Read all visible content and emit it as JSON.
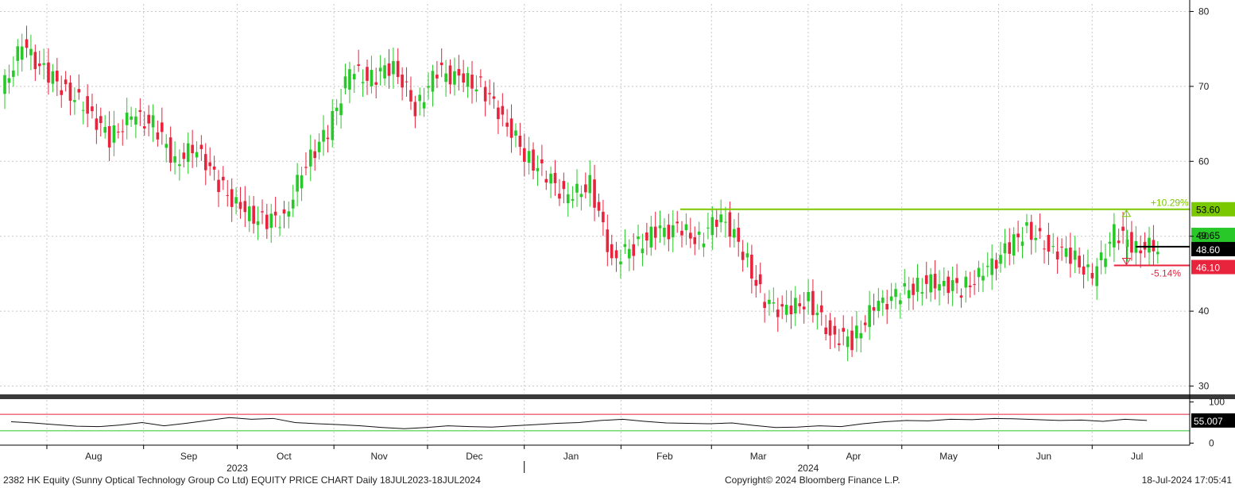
{
  "chart_data": {
    "type": "candlestick",
    "instrument": "2382 HK Equity",
    "price_axis": {
      "ticks": [
        30,
        40,
        50,
        60,
        70,
        80
      ],
      "tick_labels": [
        "30",
        "40",
        "50",
        "60",
        "70",
        "80"
      ],
      "ylim": [
        29,
        81
      ]
    },
    "osc_axis": {
      "ticks": [
        0,
        100
      ],
      "tick_labels": [
        "0",
        "100"
      ],
      "ylim": [
        -5,
        105
      ],
      "upper_band": 70,
      "lower_band": 30
    },
    "x_axis": {
      "months": [
        "Aug",
        "Sep",
        "Oct",
        "Nov",
        "Dec",
        "Jan",
        "Feb",
        "Mar",
        "Apr",
        "May",
        "Jun",
        "Jul"
      ],
      "years": [
        "2023",
        "2024"
      ],
      "start": "2023-07-18",
      "end": "2024-07-18"
    },
    "price_series": [
      {
        "date": "2023-07-18",
        "close": 69.0
      },
      {
        "date": "2023-07-25",
        "close": 75.5
      },
      {
        "date": "2023-08-01",
        "close": 72.0
      },
      {
        "date": "2023-08-08",
        "close": 69.5
      },
      {
        "date": "2023-08-15",
        "close": 67.0
      },
      {
        "date": "2023-08-22",
        "close": 63.0
      },
      {
        "date": "2023-08-29",
        "close": 66.0
      },
      {
        "date": "2023-09-05",
        "close": 65.0
      },
      {
        "date": "2023-09-12",
        "close": 60.0
      },
      {
        "date": "2023-09-19",
        "close": 62.0
      },
      {
        "date": "2023-09-26",
        "close": 57.0
      },
      {
        "date": "2023-10-03",
        "close": 53.5
      },
      {
        "date": "2023-10-10",
        "close": 52.0
      },
      {
        "date": "2023-10-17",
        "close": 52.5
      },
      {
        "date": "2023-10-24",
        "close": 60.0
      },
      {
        "date": "2023-10-31",
        "close": 64.0
      },
      {
        "date": "2023-11-07",
        "close": 72.0
      },
      {
        "date": "2023-11-14",
        "close": 71.0
      },
      {
        "date": "2023-11-21",
        "close": 73.0
      },
      {
        "date": "2023-11-28",
        "close": 67.0
      },
      {
        "date": "2023-12-05",
        "close": 72.0
      },
      {
        "date": "2023-12-12",
        "close": 71.0
      },
      {
        "date": "2023-12-19",
        "close": 70.0
      },
      {
        "date": "2023-12-26",
        "close": 66.0
      },
      {
        "date": "2024-01-02",
        "close": 61.0
      },
      {
        "date": "2024-01-09",
        "close": 58.0
      },
      {
        "date": "2024-01-16",
        "close": 55.0
      },
      {
        "date": "2024-01-23",
        "close": 57.0
      },
      {
        "date": "2024-01-30",
        "close": 47.0
      },
      {
        "date": "2024-02-06",
        "close": 48.5
      },
      {
        "date": "2024-02-13",
        "close": 50.5
      },
      {
        "date": "2024-02-20",
        "close": 51.0
      },
      {
        "date": "2024-02-27",
        "close": 49.5
      },
      {
        "date": "2024-03-05",
        "close": 53.0
      },
      {
        "date": "2024-03-12",
        "close": 48.0
      },
      {
        "date": "2024-03-19",
        "close": 41.0
      },
      {
        "date": "2024-03-26",
        "close": 40.0
      },
      {
        "date": "2024-04-02",
        "close": 41.5
      },
      {
        "date": "2024-04-09",
        "close": 37.0
      },
      {
        "date": "2024-04-16",
        "close": 36.0
      },
      {
        "date": "2024-04-23",
        "close": 40.5
      },
      {
        "date": "2024-04-30",
        "close": 42.0
      },
      {
        "date": "2024-05-07",
        "close": 43.5
      },
      {
        "date": "2024-05-14",
        "close": 44.0
      },
      {
        "date": "2024-05-21",
        "close": 43.0
      },
      {
        "date": "2024-05-28",
        "close": 45.0
      },
      {
        "date": "2024-06-04",
        "close": 48.0
      },
      {
        "date": "2024-06-11",
        "close": 51.0
      },
      {
        "date": "2024-06-18",
        "close": 48.5
      },
      {
        "date": "2024-06-25",
        "close": 47.5
      },
      {
        "date": "2024-07-02",
        "close": 44.5
      },
      {
        "date": "2024-07-09",
        "close": 50.5
      },
      {
        "date": "2024-07-16",
        "close": 48.6
      }
    ],
    "osc_series": [
      52,
      49,
      45,
      41,
      40,
      44,
      50,
      42,
      48,
      55,
      62,
      58,
      60,
      50,
      47,
      45,
      42,
      38,
      35,
      38,
      42,
      40,
      39,
      42,
      45,
      48,
      50,
      55,
      58,
      53,
      49,
      48,
      47,
      49,
      43,
      38,
      39,
      42,
      40,
      47,
      52,
      55,
      54,
      58,
      57,
      60,
      59,
      57,
      55,
      56,
      53,
      58,
      55
    ],
    "levels": [
      {
        "label": "53.60",
        "value": 53.6,
        "color": "#7ac800",
        "text_color": "#000000"
      },
      {
        "label": "49.65",
        "value": 49.65,
        "color": "#28c828",
        "text_color": "#000000"
      },
      {
        "label": "48.60",
        "value": 48.6,
        "color": "#000000",
        "text_color": "#ffffff"
      },
      {
        "label": "46.10",
        "value": 46.1,
        "color": "#e8233c",
        "text_color": "#ffffff"
      }
    ],
    "annotations": [
      {
        "text": "+10.29%",
        "color": "#7ac800"
      },
      {
        "text": "-5.14%",
        "color": "#e8233c"
      }
    ],
    "osc_last": {
      "label": "55.007"
    }
  },
  "footer": {
    "left": "2382 HK Equity (Sunny Optical Technology Group Co Ltd) EQUITY PRICE CHART  Daily 18JUL2023-18JUL2024",
    "middle": "Copyright© 2024 Bloomberg Finance L.P.",
    "right": "18-Jul-2024 17:05:41"
  },
  "colors": {
    "up": "#28c828",
    "down": "#e8233c",
    "grid": "#c8c8c8",
    "band_upper": "#e8233c",
    "band_lower": "#28c828"
  }
}
